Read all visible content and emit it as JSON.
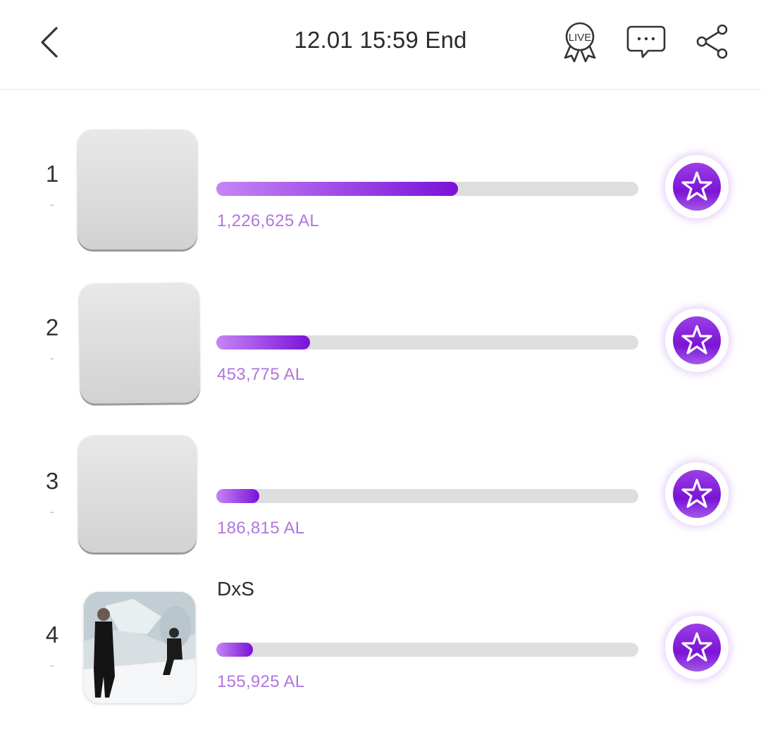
{
  "header": {
    "title": "12.01 15:59 End",
    "live_label": "LIVE"
  },
  "colors": {
    "accent": "#7a12d8",
    "accent_light": "#c586f5",
    "votes_text": "#b076de",
    "track": "#dedede"
  },
  "ranking": [
    {
      "rank": "1",
      "change": "-",
      "name": "",
      "votes": "1,226,625 AL",
      "progress": 0.573
    },
    {
      "rank": "2",
      "change": "-",
      "name": "",
      "votes": "453,775 AL",
      "progress": 0.222
    },
    {
      "rank": "3",
      "change": "-",
      "name": "",
      "votes": "186,815 AL",
      "progress": 0.102
    },
    {
      "rank": "4",
      "change": "-",
      "name": "DxS",
      "votes": "155,925 AL",
      "progress": 0.087
    }
  ]
}
